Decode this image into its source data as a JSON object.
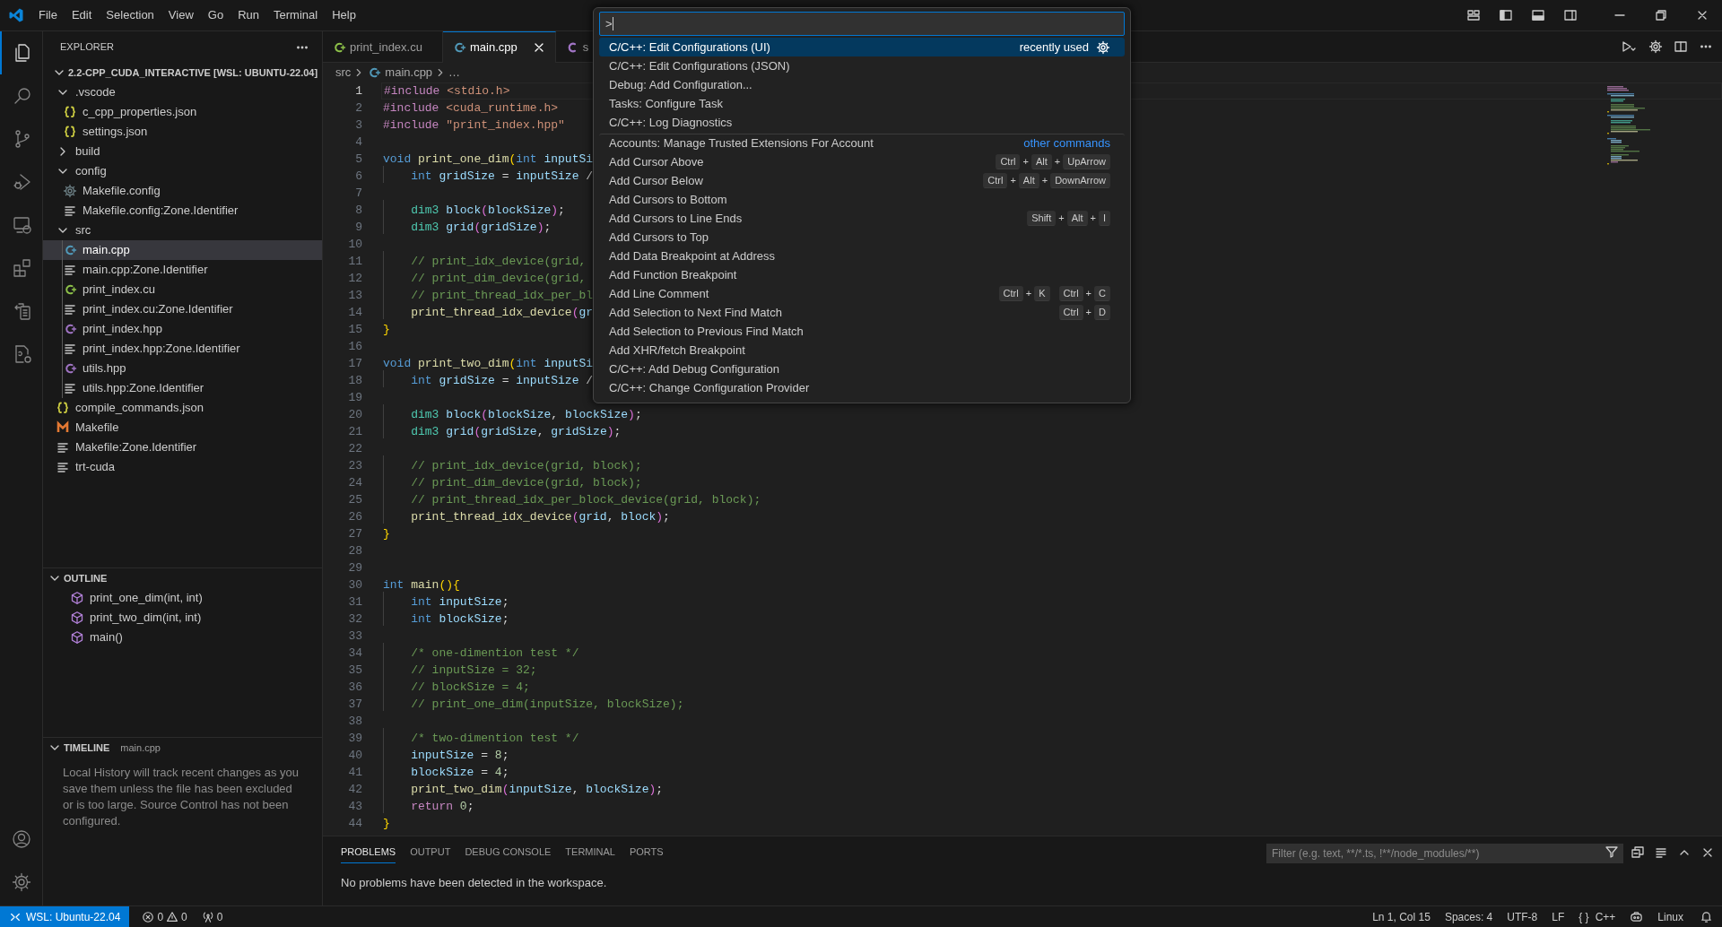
{
  "title_bar": {
    "menu": [
      "File",
      "Edit",
      "Selection",
      "View",
      "Go",
      "Run",
      "Terminal",
      "Help"
    ]
  },
  "activity_bar": {
    "items": [
      {
        "kind": "files",
        "selected": true
      },
      {
        "kind": "search",
        "selected": false
      },
      {
        "kind": "branch",
        "selected": false
      },
      {
        "kind": "debug",
        "selected": false
      },
      {
        "kind": "remote",
        "selected": false
      },
      {
        "kind": "extensions",
        "selected": false
      },
      {
        "kind": "docs",
        "selected": false
      },
      {
        "kind": "filegear",
        "selected": false
      }
    ]
  },
  "explorer": {
    "title": "EXPLORER",
    "root": {
      "label": "2.2-CPP_CUDA_INTERACTIVE [WSL: UBUNTU-22.04]",
      "expanded": true
    },
    "tree": [
      {
        "label": ".vscode",
        "kind": "folder",
        "expanded": true,
        "selected": false,
        "children": [
          {
            "label": "c_cpp_properties.json",
            "kind": "json",
            "selected": false
          },
          {
            "label": "settings.json",
            "kind": "json",
            "selected": false
          }
        ]
      },
      {
        "label": "build",
        "kind": "folder",
        "expanded": false,
        "selected": false
      },
      {
        "label": "config",
        "kind": "folder",
        "expanded": true,
        "selected": false,
        "children": [
          {
            "label": "Makefile.config",
            "kind": "gear",
            "selected": false
          },
          {
            "label": "Makefile.config:Zone.Identifier",
            "kind": "text",
            "selected": false
          }
        ]
      },
      {
        "label": "src",
        "kind": "folder",
        "expanded": true,
        "selected": false,
        "children": [
          {
            "label": "main.cpp",
            "kind": "cpp",
            "selected": true
          },
          {
            "label": "main.cpp:Zone.Identifier",
            "kind": "text",
            "selected": false
          },
          {
            "label": "print_index.cu",
            "kind": "cu",
            "selected": false
          },
          {
            "label": "print_index.cu:Zone.Identifier",
            "kind": "text",
            "selected": false
          },
          {
            "label": "print_index.hpp",
            "kind": "hpp",
            "selected": false
          },
          {
            "label": "print_index.hpp:Zone.Identifier",
            "kind": "text",
            "selected": false
          },
          {
            "label": "utils.hpp",
            "kind": "hpp",
            "selected": false
          },
          {
            "label": "utils.hpp:Zone.Identifier",
            "kind": "text",
            "selected": false
          }
        ]
      },
      {
        "label": "compile_commands.json",
        "kind": "json",
        "selected": false
      },
      {
        "label": "Makefile",
        "kind": "make",
        "selected": false
      },
      {
        "label": "Makefile:Zone.Identifier",
        "kind": "text",
        "selected": false
      },
      {
        "label": "trt-cuda",
        "kind": "text",
        "selected": false
      }
    ]
  },
  "outline": {
    "title": "OUTLINE",
    "expanded": true,
    "items": [
      "print_one_dim(int, int)",
      "print_two_dim(int, int)",
      "main()"
    ]
  },
  "timeline": {
    "title": "TIMELINE",
    "file": "main.cpp",
    "expanded": true,
    "message": "Local History will track recent changes as you save them unless the file has been excluded or is too large. Source Control has not been configured."
  },
  "tabs": [
    {
      "label": "print_index.cu",
      "kind": "cu",
      "selected": false
    },
    {
      "label": "main.cpp",
      "kind": "cpp",
      "selected": true
    },
    {
      "label": "s",
      "kind": "c",
      "selected": false
    }
  ],
  "breadcrumb": [
    {
      "label": "src",
      "kind": "folder"
    },
    {
      "label": "main.cpp",
      "kind": "cpp"
    },
    {
      "label": "…",
      "kind": "more"
    }
  ],
  "code": [
    {
      "number": "1",
      "current": true,
      "tokens": [
        {
          "kind": "pre",
          "text": "#include "
        },
        {
          "kind": "str",
          "text": "<stdio.h>"
        }
      ]
    },
    {
      "number": "2",
      "current": false,
      "tokens": [
        {
          "kind": "pre",
          "text": "#include "
        },
        {
          "kind": "str",
          "text": "<cuda_runtime.h>"
        }
      ]
    },
    {
      "number": "3",
      "current": false,
      "tokens": [
        {
          "kind": "pre",
          "text": "#include "
        },
        {
          "kind": "str",
          "text": "\"print_index.hpp\""
        }
      ]
    },
    {
      "number": "4",
      "current": false
    },
    {
      "number": "5",
      "current": false,
      "tokens": [
        {
          "kind": "kw",
          "text": "void "
        },
        {
          "kind": "fn",
          "text": "print_one_dim"
        },
        {
          "kind": "br",
          "text": "("
        },
        {
          "kind": "kw",
          "text": "int "
        },
        {
          "kind": "var",
          "text": "inputSi"
        }
      ]
    },
    {
      "number": "6",
      "current": false,
      "tokens": [
        {
          "kind": "kw",
          "text": "    int "
        },
        {
          "kind": "var",
          "text": "gridSize "
        },
        {
          "kind": "plain",
          "text": "= "
        },
        {
          "kind": "var",
          "text": "inputSize "
        },
        {
          "kind": "plain",
          "text": "/"
        }
      ]
    },
    {
      "number": "7",
      "current": false
    },
    {
      "number": "8",
      "current": false,
      "tokens": [
        {
          "kind": "type",
          "text": "    dim3 "
        },
        {
          "kind": "var",
          "text": "block"
        },
        {
          "kind": "br2",
          "text": "("
        },
        {
          "kind": "var",
          "text": "blockSize"
        },
        {
          "kind": "br2",
          "text": ")"
        },
        {
          "kind": "plain",
          "text": ";"
        }
      ]
    },
    {
      "number": "9",
      "current": false,
      "tokens": [
        {
          "kind": "type",
          "text": "    dim3 "
        },
        {
          "kind": "var",
          "text": "grid"
        },
        {
          "kind": "br2",
          "text": "("
        },
        {
          "kind": "var",
          "text": "gridSize"
        },
        {
          "kind": "br2",
          "text": ")"
        },
        {
          "kind": "plain",
          "text": ";"
        }
      ]
    },
    {
      "number": "10",
      "current": false
    },
    {
      "number": "11",
      "current": false,
      "tokens": [
        {
          "kind": "cm",
          "text": "    // print_idx_device(grid,"
        }
      ]
    },
    {
      "number": "12",
      "current": false,
      "tokens": [
        {
          "kind": "cm",
          "text": "    // print_dim_device(grid,"
        }
      ]
    },
    {
      "number": "13",
      "current": false,
      "tokens": [
        {
          "kind": "cm",
          "text": "    // print_thread_idx_per_bl"
        }
      ]
    },
    {
      "number": "14",
      "current": false,
      "tokens": [
        {
          "kind": "fn",
          "text": "    print_thread_idx_device"
        },
        {
          "kind": "br2",
          "text": "("
        },
        {
          "kind": "var",
          "text": "gr"
        }
      ]
    },
    {
      "number": "15",
      "current": false,
      "tokens": [
        {
          "kind": "br",
          "text": "}"
        }
      ]
    },
    {
      "number": "16",
      "current": false
    },
    {
      "number": "17",
      "current": false,
      "tokens": [
        {
          "kind": "kw",
          "text": "void "
        },
        {
          "kind": "fn",
          "text": "print_two_dim"
        },
        {
          "kind": "br",
          "text": "("
        },
        {
          "kind": "kw",
          "text": "int "
        },
        {
          "kind": "var",
          "text": "inputSi"
        }
      ]
    },
    {
      "number": "18",
      "current": false,
      "tokens": [
        {
          "kind": "kw",
          "text": "    int "
        },
        {
          "kind": "var",
          "text": "gridSize "
        },
        {
          "kind": "plain",
          "text": "= "
        },
        {
          "kind": "var",
          "text": "inputSize "
        },
        {
          "kind": "plain",
          "text": "/"
        }
      ]
    },
    {
      "number": "19",
      "current": false
    },
    {
      "number": "20",
      "current": false,
      "tokens": [
        {
          "kind": "type",
          "text": "    dim3 "
        },
        {
          "kind": "var",
          "text": "block"
        },
        {
          "kind": "br2",
          "text": "("
        },
        {
          "kind": "var",
          "text": "blockSize"
        },
        {
          "kind": "plain",
          "text": ", "
        },
        {
          "kind": "var",
          "text": "blockSize"
        },
        {
          "kind": "br2",
          "text": ")"
        },
        {
          "kind": "plain",
          "text": ";"
        }
      ]
    },
    {
      "number": "21",
      "current": false,
      "tokens": [
        {
          "kind": "type",
          "text": "    dim3 "
        },
        {
          "kind": "var",
          "text": "grid"
        },
        {
          "kind": "br2",
          "text": "("
        },
        {
          "kind": "var",
          "text": "gridSize"
        },
        {
          "kind": "plain",
          "text": ", "
        },
        {
          "kind": "var",
          "text": "gridSize"
        },
        {
          "kind": "br2",
          "text": ")"
        },
        {
          "kind": "plain",
          "text": ";"
        }
      ]
    },
    {
      "number": "22",
      "current": false
    },
    {
      "number": "23",
      "current": false,
      "tokens": [
        {
          "kind": "cm",
          "text": "    // print_idx_device(grid, block);"
        }
      ]
    },
    {
      "number": "24",
      "current": false,
      "tokens": [
        {
          "kind": "cm",
          "text": "    // print_dim_device(grid, block);"
        }
      ]
    },
    {
      "number": "25",
      "current": false,
      "tokens": [
        {
          "kind": "cm",
          "text": "    // print_thread_idx_per_block_device(grid, block);"
        }
      ]
    },
    {
      "number": "26",
      "current": false,
      "tokens": [
        {
          "kind": "fn",
          "text": "    print_thread_idx_device"
        },
        {
          "kind": "br2",
          "text": "("
        },
        {
          "kind": "var",
          "text": "grid"
        },
        {
          "kind": "plain",
          "text": ", "
        },
        {
          "kind": "var",
          "text": "block"
        },
        {
          "kind": "br2",
          "text": ")"
        },
        {
          "kind": "plain",
          "text": ";"
        }
      ]
    },
    {
      "number": "27",
      "current": false,
      "tokens": [
        {
          "kind": "br",
          "text": "}"
        }
      ]
    },
    {
      "number": "28",
      "current": false
    },
    {
      "number": "29",
      "current": false
    },
    {
      "number": "30",
      "current": false,
      "tokens": [
        {
          "kind": "kw",
          "text": "int "
        },
        {
          "kind": "fn",
          "text": "main"
        },
        {
          "kind": "br",
          "text": "(){"
        }
      ]
    },
    {
      "number": "31",
      "current": false,
      "tokens": [
        {
          "kind": "kw",
          "text": "    int "
        },
        {
          "kind": "var",
          "text": "inputSize"
        },
        {
          "kind": "plain",
          "text": ";"
        }
      ]
    },
    {
      "number": "32",
      "current": false,
      "tokens": [
        {
          "kind": "kw",
          "text": "    int "
        },
        {
          "kind": "var",
          "text": "blockSize"
        },
        {
          "kind": "plain",
          "text": ";"
        }
      ]
    },
    {
      "number": "33",
      "current": false
    },
    {
      "number": "34",
      "current": false,
      "tokens": [
        {
          "kind": "cm",
          "text": "    /* one-dimention test */"
        }
      ]
    },
    {
      "number": "35",
      "current": false,
      "tokens": [
        {
          "kind": "cm",
          "text": "    // inputSize = 32;"
        }
      ]
    },
    {
      "number": "36",
      "current": false,
      "tokens": [
        {
          "kind": "cm",
          "text": "    // blockSize = 4;"
        }
      ]
    },
    {
      "number": "37",
      "current": false,
      "tokens": [
        {
          "kind": "cm",
          "text": "    // print_one_dim(inputSize, blockSize);"
        }
      ]
    },
    {
      "number": "38",
      "current": false
    },
    {
      "number": "39",
      "current": false,
      "tokens": [
        {
          "kind": "cm",
          "text": "    /* two-dimention test */"
        }
      ]
    },
    {
      "number": "40",
      "current": false,
      "tokens": [
        {
          "kind": "var",
          "text": "    inputSize "
        },
        {
          "kind": "plain",
          "text": "= "
        },
        {
          "kind": "num",
          "text": "8"
        },
        {
          "kind": "plain",
          "text": ";"
        }
      ]
    },
    {
      "number": "41",
      "current": false,
      "tokens": [
        {
          "kind": "var",
          "text": "    blockSize "
        },
        {
          "kind": "plain",
          "text": "= "
        },
        {
          "kind": "num",
          "text": "4"
        },
        {
          "kind": "plain",
          "text": ";"
        }
      ]
    },
    {
      "number": "42",
      "current": false,
      "tokens": [
        {
          "kind": "fn",
          "text": "    print_two_dim"
        },
        {
          "kind": "br2",
          "text": "("
        },
        {
          "kind": "var",
          "text": "inputSize"
        },
        {
          "kind": "plain",
          "text": ", "
        },
        {
          "kind": "var",
          "text": "blockSize"
        },
        {
          "kind": "br2",
          "text": ")"
        },
        {
          "kind": "plain",
          "text": ";"
        }
      ]
    },
    {
      "number": "43",
      "current": false,
      "tokens": [
        {
          "kind": "ctl",
          "text": "    return "
        },
        {
          "kind": "num",
          "text": "0"
        },
        {
          "kind": "plain",
          "text": ";"
        }
      ]
    },
    {
      "number": "44",
      "current": false,
      "tokens": [
        {
          "kind": "br",
          "text": "}"
        }
      ]
    }
  ],
  "command_palette": {
    "input": ">",
    "items": [
      {
        "label": "C/C++: Edit Configurations (UI)",
        "selected": true,
        "separator_before": false,
        "detail": "recently used"
      },
      {
        "label": "C/C++: Edit Configurations (JSON)",
        "selected": false,
        "separator_before": false
      },
      {
        "label": "Debug: Add Configuration...",
        "selected": false,
        "separator_before": false
      },
      {
        "label": "Tasks: Configure Task",
        "selected": false,
        "separator_before": false
      },
      {
        "label": "C/C++: Log Diagnostics",
        "selected": false,
        "separator_before": false
      },
      {
        "label": "Accounts: Manage Trusted Extensions For Account",
        "selected": false,
        "separator_before": true,
        "link": "other commands"
      },
      {
        "label": "Add Cursor Above",
        "selected": false,
        "separator_before": false,
        "keys": [
          [
            "Ctrl",
            "Alt",
            "UpArrow"
          ]
        ],
        "key_joiner": "+"
      },
      {
        "label": "Add Cursor Below",
        "selected": false,
        "separator_before": false,
        "keys": [
          [
            "Ctrl",
            "Alt",
            "DownArrow"
          ]
        ],
        "key_joiner": "+"
      },
      {
        "label": "Add Cursors to Bottom",
        "selected": false,
        "separator_before": false
      },
      {
        "label": "Add Cursors to Line Ends",
        "selected": false,
        "separator_before": false,
        "keys": [
          [
            "Shift",
            "Alt",
            "I"
          ]
        ],
        "key_joiner": "+"
      },
      {
        "label": "Add Cursors to Top",
        "selected": false,
        "separator_before": false
      },
      {
        "label": "Add Data Breakpoint at Address",
        "selected": false,
        "separator_before": false
      },
      {
        "label": "Add Function Breakpoint",
        "selected": false,
        "separator_before": false
      },
      {
        "label": "Add Line Comment",
        "selected": false,
        "separator_before": false,
        "keys": [
          [
            "Ctrl",
            "K"
          ],
          [
            "Ctrl",
            "C"
          ]
        ],
        "key_joiner": "+"
      },
      {
        "label": "Add Selection to Next Find Match",
        "selected": false,
        "separator_before": false,
        "keys": [
          [
            "Ctrl",
            "D"
          ]
        ],
        "key_joiner": "+"
      },
      {
        "label": "Add Selection to Previous Find Match",
        "selected": false,
        "separator_before": false
      },
      {
        "label": "Add XHR/fetch Breakpoint",
        "selected": false,
        "separator_before": false
      },
      {
        "label": "C/C++: Add Debug Configuration",
        "selected": false,
        "separator_before": false
      },
      {
        "label": "C/C++: Change Configuration Provider",
        "selected": false,
        "separator_before": false
      }
    ]
  },
  "panel": {
    "tabs": [
      {
        "label": "PROBLEMS",
        "selected": true
      },
      {
        "label": "OUTPUT",
        "selected": false
      },
      {
        "label": "DEBUG CONSOLE",
        "selected": false
      },
      {
        "label": "TERMINAL",
        "selected": false
      },
      {
        "label": "PORTS",
        "selected": false
      }
    ],
    "filter": {
      "placeholder": "Filter (e.g. text, **/*.ts, !**/node_modules/**)"
    },
    "message": "No problems have been detected in the workspace."
  },
  "status_bar": {
    "remote": "WSL: Ubuntu-22.04",
    "errors": "0",
    "warnings": "0",
    "ports": "0",
    "position": "Ln 1, Col 15",
    "indentation": "Spaces: 4",
    "encoding": "UTF-8",
    "line_ending": "LF",
    "language_glyph": "{ }",
    "language": "C++",
    "os": "Linux"
  }
}
